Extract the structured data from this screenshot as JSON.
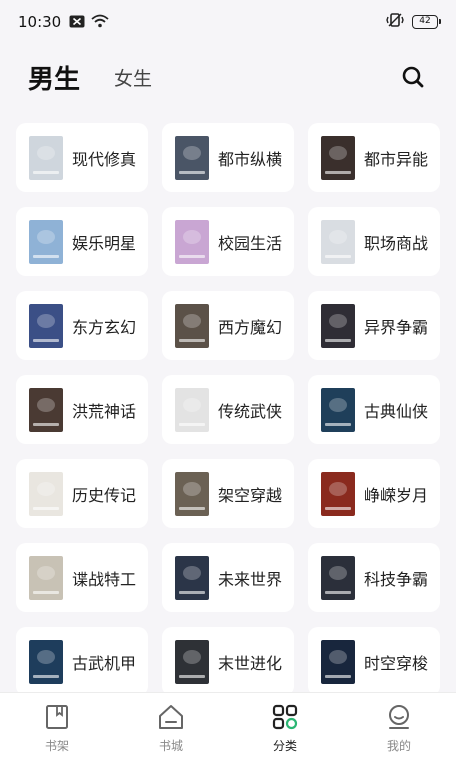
{
  "status_bar": {
    "time": "10:30",
    "battery": "42"
  },
  "header": {
    "tabs": [
      {
        "label": "男生",
        "active": true
      },
      {
        "label": "女生",
        "active": false
      }
    ],
    "search_icon": "search-icon"
  },
  "categories": [
    {
      "label": "现代修真",
      "cover_color": "#cfd6dd"
    },
    {
      "label": "都市纵横",
      "cover_color": "#4a5566"
    },
    {
      "label": "都市异能",
      "cover_color": "#3a2f2c"
    },
    {
      "label": "娱乐明星",
      "cover_color": "#8fb2d6"
    },
    {
      "label": "校园生活",
      "cover_color": "#c9a6d3"
    },
    {
      "label": "职场商战",
      "cover_color": "#d9dde2"
    },
    {
      "label": "东方玄幻",
      "cover_color": "#3b4f86"
    },
    {
      "label": "西方魔幻",
      "cover_color": "#5b5148"
    },
    {
      "label": "异界争霸",
      "cover_color": "#2f2d35"
    },
    {
      "label": "洪荒神话",
      "cover_color": "#4a3a33"
    },
    {
      "label": "传统武侠",
      "cover_color": "#e3e3e3"
    },
    {
      "label": "古典仙侠",
      "cover_color": "#1f3f5a"
    },
    {
      "label": "历史传记",
      "cover_color": "#e9e6e0"
    },
    {
      "label": "架空穿越",
      "cover_color": "#6b6154"
    },
    {
      "label": "峥嵘岁月",
      "cover_color": "#8a2a1e"
    },
    {
      "label": "谍战特工",
      "cover_color": "#c8c2b5"
    },
    {
      "label": "未来世界",
      "cover_color": "#2b3548"
    },
    {
      "label": "科技争霸",
      "cover_color": "#2b2f3a"
    },
    {
      "label": "古武机甲",
      "cover_color": "#1e3d5c"
    },
    {
      "label": "末世进化",
      "cover_color": "#2e3136"
    },
    {
      "label": "时空穿梭",
      "cover_color": "#18263d"
    }
  ],
  "bottom_nav": [
    {
      "label": "书架",
      "icon": "bookshelf-icon",
      "active": false
    },
    {
      "label": "书城",
      "icon": "home-icon",
      "active": false
    },
    {
      "label": "分类",
      "icon": "category-grid-icon",
      "active": true
    },
    {
      "label": "我的",
      "icon": "profile-icon",
      "active": false
    }
  ]
}
